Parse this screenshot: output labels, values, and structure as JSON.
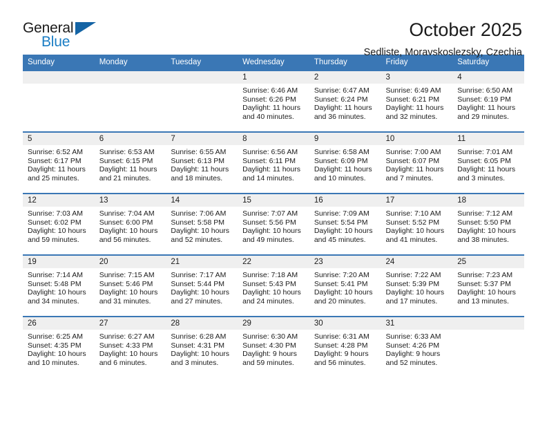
{
  "logo": {
    "line1": "General",
    "line2": "Blue",
    "triangle_color": "#1464a5",
    "blue_text_color": "#1a7dc4"
  },
  "header": {
    "title": "October 2025",
    "subtitle": "Sedliste, Moravskoslezsky, Czechia"
  },
  "theme": {
    "header_blue": "#3a77b5",
    "daynum_gray": "#efefef",
    "text": "#1b1b1b"
  },
  "weekdays": [
    "Sunday",
    "Monday",
    "Tuesday",
    "Wednesday",
    "Thursday",
    "Friday",
    "Saturday"
  ],
  "labels": {
    "sunrise_prefix": "Sunrise: ",
    "sunset_prefix": "Sunset: ",
    "daylight_prefix": "Daylight: "
  },
  "weeks": [
    [
      {
        "day": "",
        "empty": true
      },
      {
        "day": "",
        "empty": true
      },
      {
        "day": "",
        "empty": true
      },
      {
        "day": "1",
        "sunrise": "Sunrise: 6:46 AM",
        "sunset": "Sunset: 6:26 PM",
        "daylight": "Daylight: 11 hours and 40 minutes."
      },
      {
        "day": "2",
        "sunrise": "Sunrise: 6:47 AM",
        "sunset": "Sunset: 6:24 PM",
        "daylight": "Daylight: 11 hours and 36 minutes."
      },
      {
        "day": "3",
        "sunrise": "Sunrise: 6:49 AM",
        "sunset": "Sunset: 6:21 PM",
        "daylight": "Daylight: 11 hours and 32 minutes."
      },
      {
        "day": "4",
        "sunrise": "Sunrise: 6:50 AM",
        "sunset": "Sunset: 6:19 PM",
        "daylight": "Daylight: 11 hours and 29 minutes."
      }
    ],
    [
      {
        "day": "5",
        "sunrise": "Sunrise: 6:52 AM",
        "sunset": "Sunset: 6:17 PM",
        "daylight": "Daylight: 11 hours and 25 minutes."
      },
      {
        "day": "6",
        "sunrise": "Sunrise: 6:53 AM",
        "sunset": "Sunset: 6:15 PM",
        "daylight": "Daylight: 11 hours and 21 minutes."
      },
      {
        "day": "7",
        "sunrise": "Sunrise: 6:55 AM",
        "sunset": "Sunset: 6:13 PM",
        "daylight": "Daylight: 11 hours and 18 minutes."
      },
      {
        "day": "8",
        "sunrise": "Sunrise: 6:56 AM",
        "sunset": "Sunset: 6:11 PM",
        "daylight": "Daylight: 11 hours and 14 minutes."
      },
      {
        "day": "9",
        "sunrise": "Sunrise: 6:58 AM",
        "sunset": "Sunset: 6:09 PM",
        "daylight": "Daylight: 11 hours and 10 minutes."
      },
      {
        "day": "10",
        "sunrise": "Sunrise: 7:00 AM",
        "sunset": "Sunset: 6:07 PM",
        "daylight": "Daylight: 11 hours and 7 minutes."
      },
      {
        "day": "11",
        "sunrise": "Sunrise: 7:01 AM",
        "sunset": "Sunset: 6:05 PM",
        "daylight": "Daylight: 11 hours and 3 minutes."
      }
    ],
    [
      {
        "day": "12",
        "sunrise": "Sunrise: 7:03 AM",
        "sunset": "Sunset: 6:02 PM",
        "daylight": "Daylight: 10 hours and 59 minutes."
      },
      {
        "day": "13",
        "sunrise": "Sunrise: 7:04 AM",
        "sunset": "Sunset: 6:00 PM",
        "daylight": "Daylight: 10 hours and 56 minutes."
      },
      {
        "day": "14",
        "sunrise": "Sunrise: 7:06 AM",
        "sunset": "Sunset: 5:58 PM",
        "daylight": "Daylight: 10 hours and 52 minutes."
      },
      {
        "day": "15",
        "sunrise": "Sunrise: 7:07 AM",
        "sunset": "Sunset: 5:56 PM",
        "daylight": "Daylight: 10 hours and 49 minutes."
      },
      {
        "day": "16",
        "sunrise": "Sunrise: 7:09 AM",
        "sunset": "Sunset: 5:54 PM",
        "daylight": "Daylight: 10 hours and 45 minutes."
      },
      {
        "day": "17",
        "sunrise": "Sunrise: 7:10 AM",
        "sunset": "Sunset: 5:52 PM",
        "daylight": "Daylight: 10 hours and 41 minutes."
      },
      {
        "day": "18",
        "sunrise": "Sunrise: 7:12 AM",
        "sunset": "Sunset: 5:50 PM",
        "daylight": "Daylight: 10 hours and 38 minutes."
      }
    ],
    [
      {
        "day": "19",
        "sunrise": "Sunrise: 7:14 AM",
        "sunset": "Sunset: 5:48 PM",
        "daylight": "Daylight: 10 hours and 34 minutes."
      },
      {
        "day": "20",
        "sunrise": "Sunrise: 7:15 AM",
        "sunset": "Sunset: 5:46 PM",
        "daylight": "Daylight: 10 hours and 31 minutes."
      },
      {
        "day": "21",
        "sunrise": "Sunrise: 7:17 AM",
        "sunset": "Sunset: 5:44 PM",
        "daylight": "Daylight: 10 hours and 27 minutes."
      },
      {
        "day": "22",
        "sunrise": "Sunrise: 7:18 AM",
        "sunset": "Sunset: 5:43 PM",
        "daylight": "Daylight: 10 hours and 24 minutes."
      },
      {
        "day": "23",
        "sunrise": "Sunrise: 7:20 AM",
        "sunset": "Sunset: 5:41 PM",
        "daylight": "Daylight: 10 hours and 20 minutes."
      },
      {
        "day": "24",
        "sunrise": "Sunrise: 7:22 AM",
        "sunset": "Sunset: 5:39 PM",
        "daylight": "Daylight: 10 hours and 17 minutes."
      },
      {
        "day": "25",
        "sunrise": "Sunrise: 7:23 AM",
        "sunset": "Sunset: 5:37 PM",
        "daylight": "Daylight: 10 hours and 13 minutes."
      }
    ],
    [
      {
        "day": "26",
        "sunrise": "Sunrise: 6:25 AM",
        "sunset": "Sunset: 4:35 PM",
        "daylight": "Daylight: 10 hours and 10 minutes."
      },
      {
        "day": "27",
        "sunrise": "Sunrise: 6:27 AM",
        "sunset": "Sunset: 4:33 PM",
        "daylight": "Daylight: 10 hours and 6 minutes."
      },
      {
        "day": "28",
        "sunrise": "Sunrise: 6:28 AM",
        "sunset": "Sunset: 4:31 PM",
        "daylight": "Daylight: 10 hours and 3 minutes."
      },
      {
        "day": "29",
        "sunrise": "Sunrise: 6:30 AM",
        "sunset": "Sunset: 4:30 PM",
        "daylight": "Daylight: 9 hours and 59 minutes."
      },
      {
        "day": "30",
        "sunrise": "Sunrise: 6:31 AM",
        "sunset": "Sunset: 4:28 PM",
        "daylight": "Daylight: 9 hours and 56 minutes."
      },
      {
        "day": "31",
        "sunrise": "Sunrise: 6:33 AM",
        "sunset": "Sunset: 4:26 PM",
        "daylight": "Daylight: 9 hours and 52 minutes."
      },
      {
        "day": "",
        "empty": true
      }
    ]
  ]
}
